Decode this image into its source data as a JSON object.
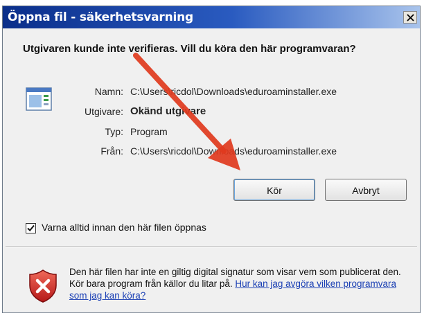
{
  "window": {
    "title": "Öppna fil - säkerhetsvarning",
    "close_glyph": "×"
  },
  "question": "Utgivaren kunde inte verifieras. Vill du köra den här programvaran?",
  "file_info": {
    "name_label": "Namn:",
    "name_value": "C:\\Users\\ricdol\\Downloads\\eduroaminstaller.exe",
    "publisher_label": "Utgivare:",
    "publisher_value": "Okänd utgivare",
    "type_label": "Typ:",
    "type_value": "Program",
    "from_label": "Från:",
    "from_value": "C:\\Users\\ricdol\\Downloads\\eduroaminstaller.exe"
  },
  "buttons": {
    "run_label": "Kör",
    "cancel_label": "Avbryt"
  },
  "checkbox": {
    "label": "Varna alltid innan den här filen öppnas",
    "checked": true
  },
  "warning": {
    "text": "Den här filen har inte en giltig digital signatur som visar vem som publicerat den. Kör bara program från källor du litar på.",
    "link_text": "Hur kan jag avgöra vilken programvara som jag kan köra?"
  },
  "colors": {
    "title_bar_start": "#0a2e8a",
    "title_bar_end": "#a9c4ec",
    "annotation_arrow": "#e03a1e",
    "link": "#1a3fb4",
    "shield_red": "#d42a2a"
  },
  "icons": {
    "app": "application-window-icon",
    "shield": "security-shield-x-icon",
    "close": "close-icon",
    "check": "checkmark-icon"
  }
}
